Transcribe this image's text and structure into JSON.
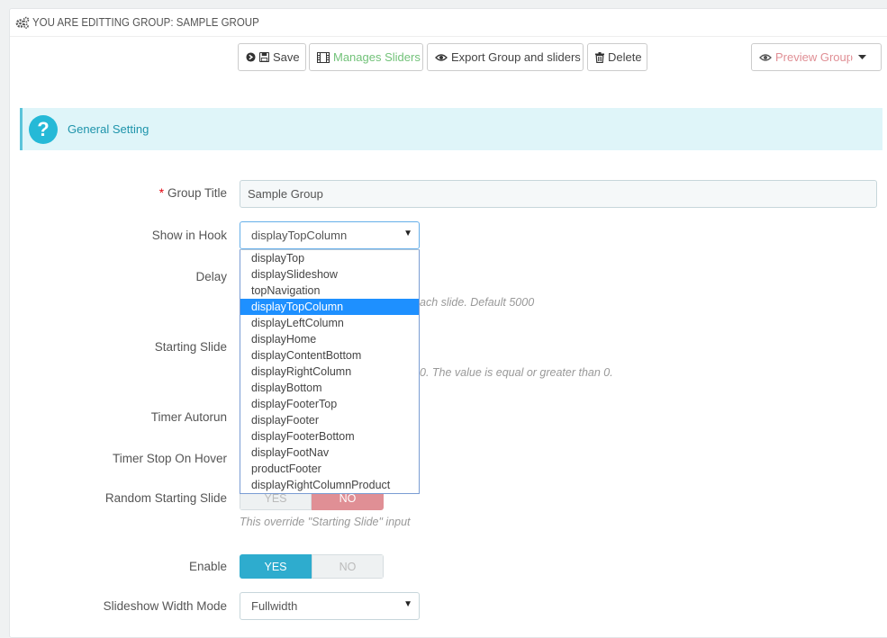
{
  "header": {
    "title": "YOU ARE EDITTING GROUP: SAMPLE GROUP",
    "icon": "gears-icon"
  },
  "toolbar": {
    "save_label": "Save",
    "manage_sliders_label": "Manages Sliders",
    "export_label": "Export Group and sliders",
    "delete_label": "Delete",
    "preview_label": "Preview Group"
  },
  "alert": {
    "text": "General Setting"
  },
  "form": {
    "group_title": {
      "label": "Group Title",
      "value": "Sample Group",
      "required": "*"
    },
    "show_in_hook": {
      "label": "Show in Hook",
      "value": "displayTopColumn",
      "options": [
        "displayTop",
        "displaySlideshow",
        "topNavigation",
        "displayTopColumn",
        "displayLeftColumn",
        "displayHome",
        "displayContentBottom",
        "displayRightColumn",
        "displayBottom",
        "displayFooterTop",
        "displayFooter",
        "displayFooterBottom",
        "displayFootNav",
        "productFooter",
        "displayRightColumnProduct"
      ],
      "selected_index": 3
    },
    "delay": {
      "label": "Delay",
      "help": "ach slide. Default 5000"
    },
    "starting_slide": {
      "label": "Starting Slide",
      "help": "0. The value is equal or greater than 0."
    },
    "timer_autorun": {
      "label": "Timer Autorun"
    },
    "timer_stop_on_hover": {
      "label": "Timer Stop On Hover"
    },
    "random_starting_slide": {
      "label": "Random Starting Slide",
      "yes": "YES",
      "no": "NO",
      "state": "no",
      "help": "This override \"Starting Slide\" input"
    },
    "enable": {
      "label": "Enable",
      "yes": "YES",
      "no": "NO",
      "state": "yes"
    },
    "slideshow_width_mode": {
      "label": "Slideshow Width Mode",
      "value": "Fullwidth"
    }
  },
  "colors": {
    "accent": "#25b9d7",
    "toggle_yes": "#2eacce",
    "toggle_no": "#e08f95",
    "required": "#e3000b"
  }
}
